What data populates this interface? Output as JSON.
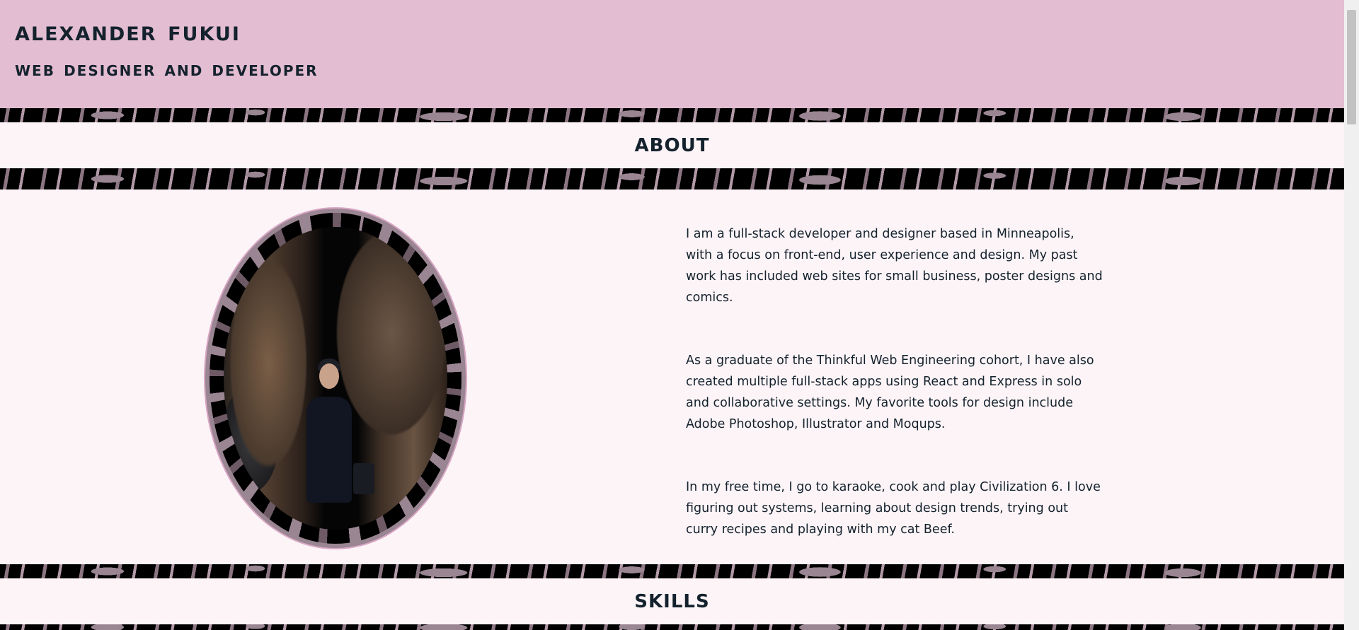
{
  "header": {
    "name": "Alexander Fukui",
    "role": "Web Designer and Developer",
    "background_color": "#e3bdd2"
  },
  "about": {
    "title": "ABOUT",
    "portrait_alt": "portrait",
    "paragraphs": [
      "I am a full-stack developer and designer based in Minneapolis, with a focus on front-end, user experience and design. My past work has included web sites for small business, poster designs and comics.",
      "As a graduate of the Thinkful Web Engineering cohort, I have also created multiple full-stack apps using React and Express in solo and collaborative settings. My favorite tools for design include Adobe Photoshop, Illustrator and Moqups.",
      "In my free time, I go to karaoke, cook and play Civilization 6. I love figuring out systems, learning about design trends, trying out curry recipes and playing with my cat Beef."
    ]
  },
  "skills": {
    "title": "SKILLS"
  },
  "colors": {
    "text": "#14222d",
    "page_background": "#fcf4f7",
    "texture_light": "#9a8592",
    "texture_dark": "#000000",
    "portrait_border": "#d8a6c4"
  }
}
